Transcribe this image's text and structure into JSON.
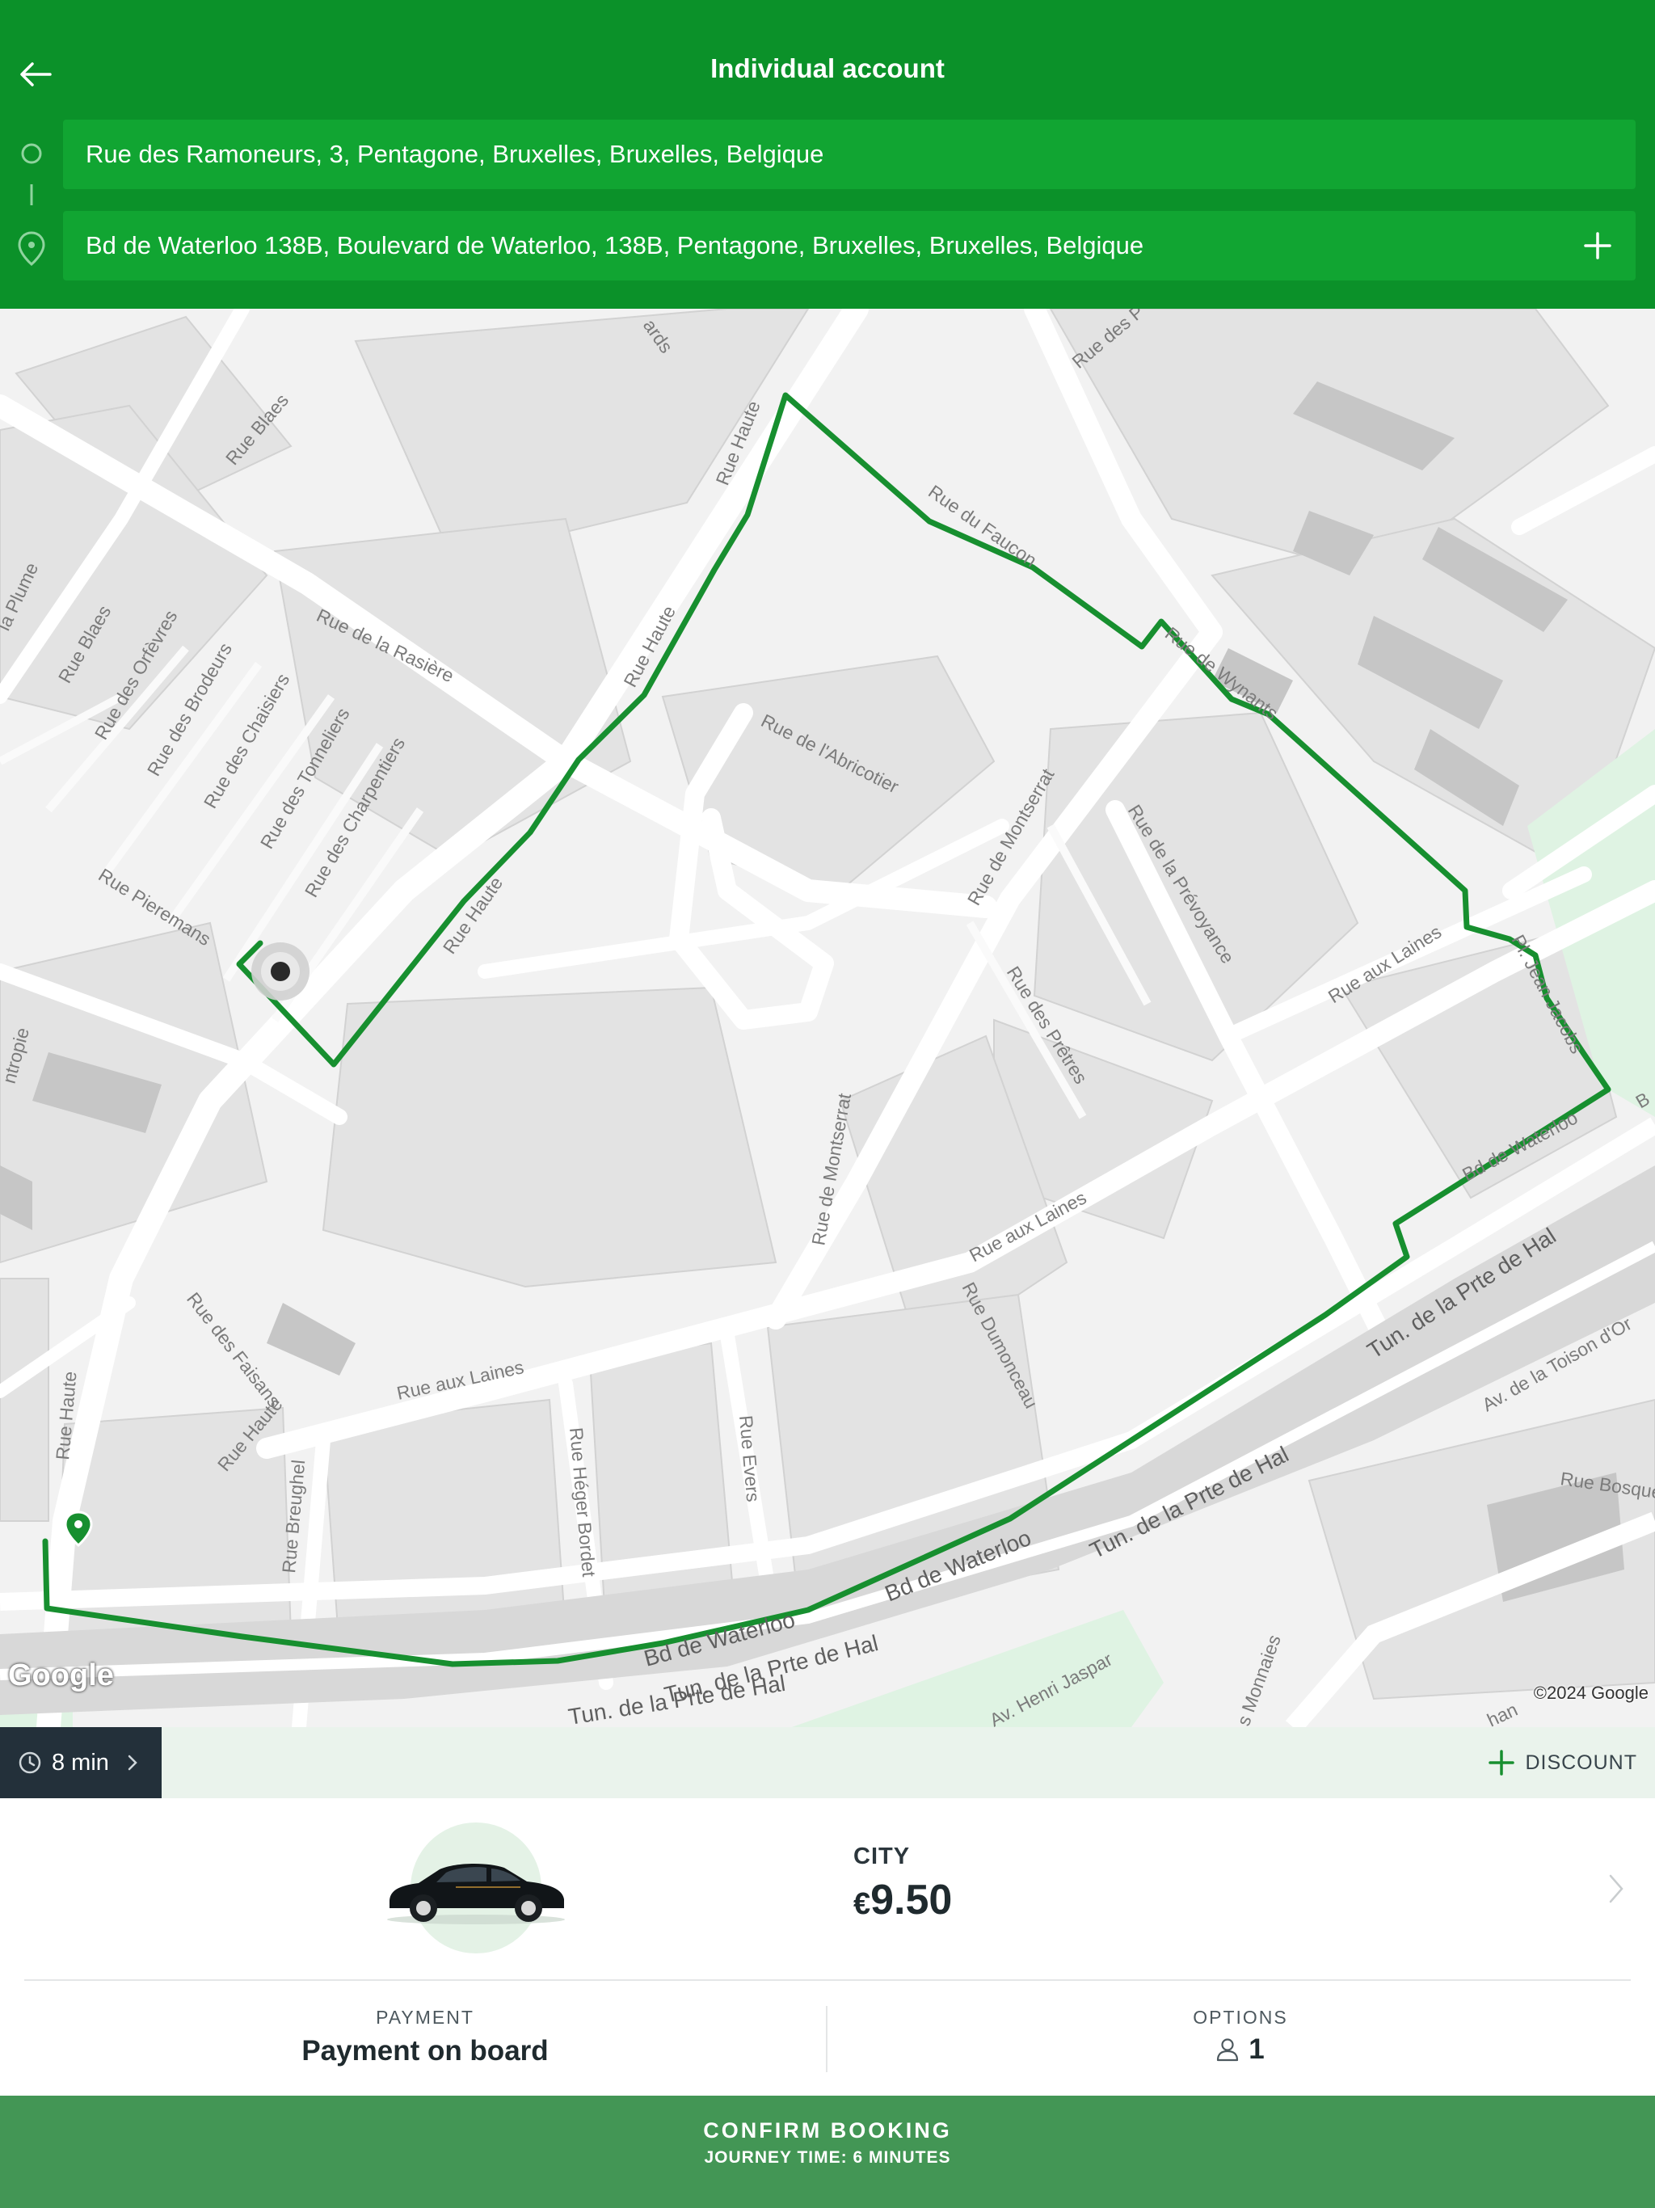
{
  "header": {
    "title": "Individual account",
    "back_icon": "arrow-left-icon",
    "origin": "Rue des Ramoneurs, 3, Pentagone, Bruxelles, Bruxelles, Belgique",
    "destination": "Bd de Waterloo 138B, Boulevard de Waterloo, 138B, Pentagone, Bruxelles, Bruxelles, Belgique",
    "add_stop_icon": "plus-icon"
  },
  "map": {
    "logo": "Google",
    "copyright": "©2024 Google",
    "route_color": "#178f2f",
    "streets": [
      "Rue Haute",
      "Rue Haute",
      "Rue Haute",
      "Rue Haute",
      "Rue Haute",
      "Rue du Faucon",
      "Rue de Wynants",
      "Rue de la Rasière",
      "Rue de l'Abricotier",
      "Rue de Montserrat",
      "Rue de Montserrat",
      "Rue de la Prévoyance",
      "Rue des Prêtres",
      "Rue aux Laines",
      "Rue aux Laines",
      "Rue aux Laines",
      "Pl. Jean Jacobs",
      "Bd de Waterloo",
      "Bd de Waterloo",
      "Bd de Waterloo",
      "Tun. de la Prte de Hal",
      "Tun. de la Prte de Hal",
      "Tun. de la Prte de Hal",
      "Tun. de la Prte de Hal",
      "Av. de la Toison d'Or",
      "Rue Bosquet",
      "Av. Henri Jaspar",
      "s Monnaies",
      "Rue Dumonceau",
      "Rue Evers",
      "Rue Héger Bordet",
      "Rue Breughel",
      "Rue des Faisans",
      "Rue Pieremans",
      "Rue des Charpentiers",
      "Rue des Tonneliers",
      "Rue des Chaisiers",
      "Rue des Brodeurs",
      "Rue des Orfèvres",
      "Rue Blaes",
      "Rue Blaes",
      "la Plume",
      "ntropie",
      "Rue des P",
      "ards",
      "B",
      "han"
    ]
  },
  "strip": {
    "eta": "8 min",
    "clock_icon": "clock-icon",
    "discount_label": "DISCOUNT"
  },
  "vehicle": {
    "category": "CITY",
    "currency": "€",
    "amount": "9.50",
    "icon": "car-icon"
  },
  "payment": {
    "label": "PAYMENT",
    "value": "Payment on board"
  },
  "options": {
    "label": "OPTIONS",
    "passengers": "1",
    "icon": "person-icon"
  },
  "confirm": {
    "label": "CONFIRM BOOKING",
    "sub": "JOURNEY TIME: 6 MINUTES"
  },
  "colors": {
    "header_bg": "#0b9129",
    "field_bg": "#11a532",
    "confirm_bg": "#439655",
    "eta_bg": "#23303a"
  }
}
